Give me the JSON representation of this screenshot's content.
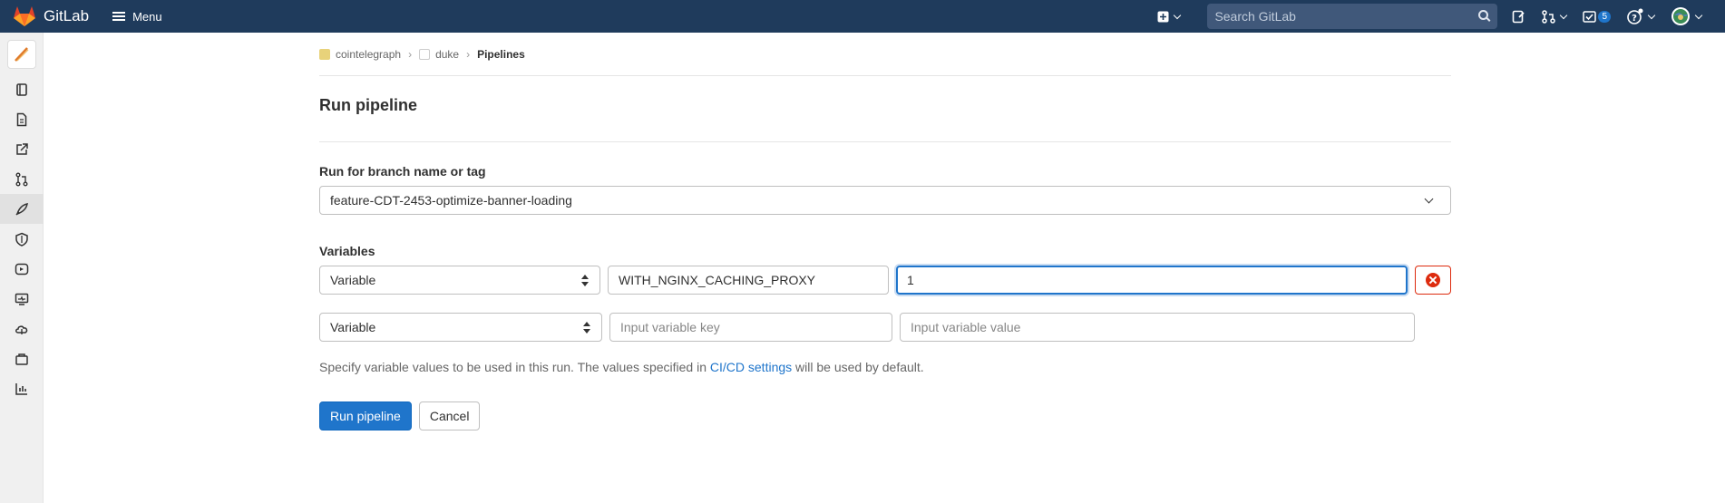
{
  "app": {
    "name": "GitLab",
    "menu_label": "Menu",
    "brand_color": "#1f3b5c",
    "accent_color": "#1f75cb"
  },
  "topbar": {
    "search_placeholder": "Search GitLab",
    "todo_count": "5",
    "icons": [
      "plus-square-icon",
      "search-icon",
      "issues-icon",
      "merge-request-icon",
      "todo-icon",
      "help-icon",
      "user-avatar"
    ]
  },
  "sidebar": {
    "items": [
      "project-overview-icon",
      "repository-icon",
      "external-link-icon",
      "merge-requests-icon",
      "ci-cd-icon",
      "security-icon",
      "deployments-icon",
      "monitor-icon",
      "infrastructure-icon",
      "packages-icon",
      "analytics-icon"
    ],
    "active": "ci-cd-icon"
  },
  "breadcrumb": {
    "group": "cointelegraph",
    "project": "duke",
    "current": "Pipelines"
  },
  "page": {
    "title": "Run pipeline"
  },
  "form": {
    "branch_label": "Run for branch name or tag",
    "branch_value": "feature-CDT-2453-optimize-banner-loading",
    "variables_label": "Variables",
    "variables": [
      {
        "type": "Variable",
        "key": "WITH_NGINX_CACHING_PROXY",
        "value": "1"
      },
      {
        "type": "Variable",
        "key_placeholder": "Input variable key",
        "value_placeholder": "Input variable value"
      }
    ],
    "help_before": "Specify variable values to be used in this run. The values specified in ",
    "help_link": "CI/CD settings",
    "help_after": " will be used by default.",
    "submit_label": "Run pipeline",
    "cancel_label": "Cancel"
  }
}
